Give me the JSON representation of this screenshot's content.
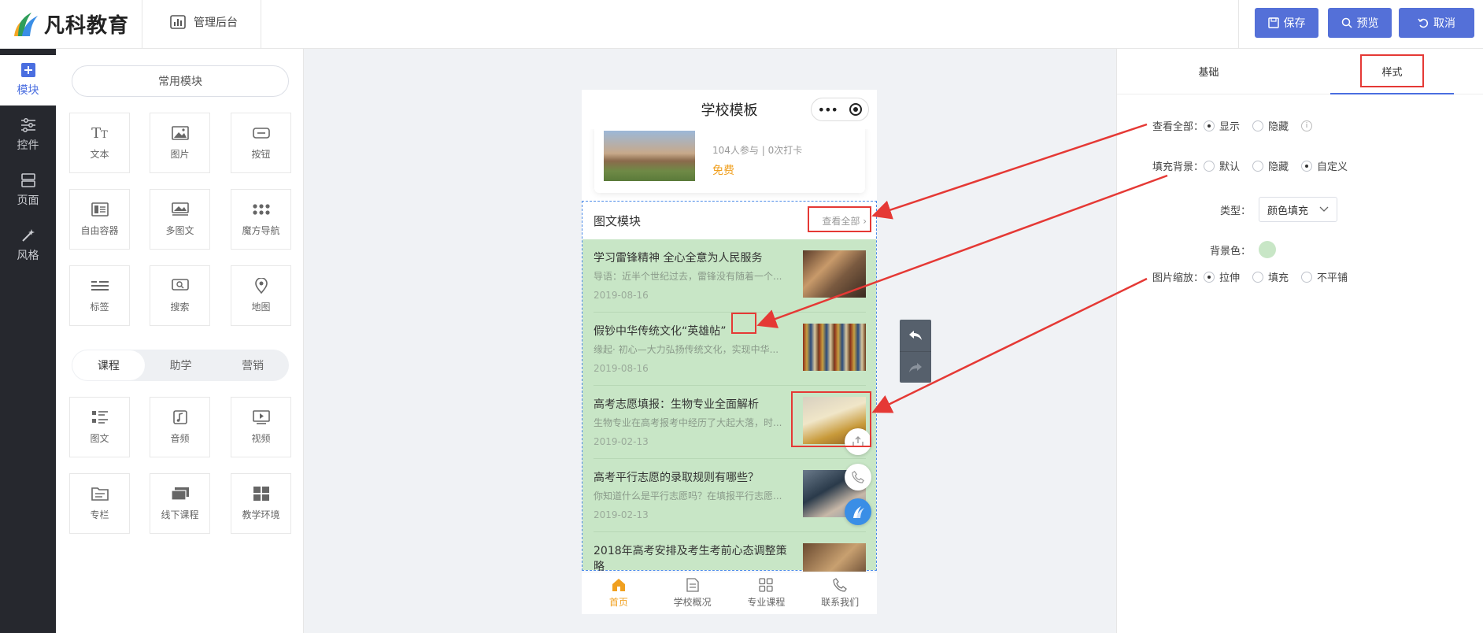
{
  "header": {
    "brand": "凡科教育",
    "admin_label": "管理后台",
    "save_label": "保存",
    "preview_label": "预览",
    "cancel_label": "取消"
  },
  "rail": {
    "items": [
      {
        "label": "模块",
        "icon": "plus-square-icon"
      },
      {
        "label": "控件",
        "icon": "sliders-icon"
      },
      {
        "label": "页面",
        "icon": "pages-icon"
      },
      {
        "label": "风格",
        "icon": "wand-icon"
      }
    ]
  },
  "modules": {
    "common_label": "常用模块",
    "common": [
      {
        "label": "文本",
        "icon": "text-icon"
      },
      {
        "label": "图片",
        "icon": "image-icon"
      },
      {
        "label": "按钮",
        "icon": "button-icon"
      },
      {
        "label": "自由容器",
        "icon": "container-icon"
      },
      {
        "label": "多图文",
        "icon": "multi-image-icon"
      },
      {
        "label": "魔方导航",
        "icon": "grid-dots-icon"
      },
      {
        "label": "标签",
        "icon": "tag-icon"
      },
      {
        "label": "搜索",
        "icon": "search-icon"
      },
      {
        "label": "地图",
        "icon": "map-pin-icon"
      }
    ],
    "segments": [
      "课程",
      "助学",
      "营销"
    ],
    "course": [
      {
        "label": "图文",
        "icon": "article-icon"
      },
      {
        "label": "音频",
        "icon": "audio-icon"
      },
      {
        "label": "视频",
        "icon": "video-icon"
      },
      {
        "label": "专栏",
        "icon": "column-icon"
      },
      {
        "label": "线下课程",
        "icon": "offline-course-icon"
      },
      {
        "label": "教学环境",
        "icon": "environment-icon"
      }
    ]
  },
  "phone": {
    "title": "学校模板",
    "course_meta": "104人参与 | 0次打卡",
    "course_price": "免费",
    "tw_title": "图文模块",
    "tw_more": "查看全部",
    "articles": [
      {
        "title": "学习雷锋精神 全心全意为人民服务",
        "desc": "导语：近半个世纪过去，雷锋没有随着一个...",
        "date": "2019-08-16",
        "thumb": "classroom"
      },
      {
        "title": "假钞中华传统文化“英雄帖”",
        "desc": "缘起· 初心—大力弘扬传统文化，实现中华...",
        "date": "2019-08-16",
        "thumb": "bookshelf"
      },
      {
        "title": "高考志愿填报：生物专业全面解析",
        "desc": "生物专业在高考报考中经历了大起大落，时...",
        "date": "2019-02-13",
        "thumb": "book"
      },
      {
        "title": "高考平行志愿的录取规则有哪些？",
        "desc": "你知道什么是平行志愿吗？在填报平行志愿...",
        "date": "2019-02-13",
        "thumb": "laptop"
      },
      {
        "title": "2018年高考安排及考生考前心态调整策略",
        "desc": "",
        "date": "",
        "thumb": "library"
      }
    ],
    "tabs": [
      {
        "label": "首页",
        "icon": "home-icon"
      },
      {
        "label": "学校概况",
        "icon": "document-icon"
      },
      {
        "label": "专业课程",
        "icon": "apps-icon"
      },
      {
        "label": "联系我们",
        "icon": "phone-icon"
      }
    ]
  },
  "settings": {
    "tabs": [
      "基础",
      "样式"
    ],
    "view_all_label": "查看全部：",
    "view_all_options": [
      "显示",
      "隐藏"
    ],
    "fill_bg_label": "填充背景：",
    "fill_bg_options": [
      "默认",
      "隐藏",
      "自定义"
    ],
    "type_label": "类型：",
    "type_value": "颜色填充",
    "bg_color_label": "背景色：",
    "bg_color": "#c8e6c6",
    "img_scale_label": "图片缩放：",
    "img_scale_options": [
      "拉伸",
      "填充",
      "不平铺"
    ]
  },
  "colors": {
    "accent": "#5470d8",
    "annotation": "#e53935",
    "tab_active": "#f0a020"
  }
}
